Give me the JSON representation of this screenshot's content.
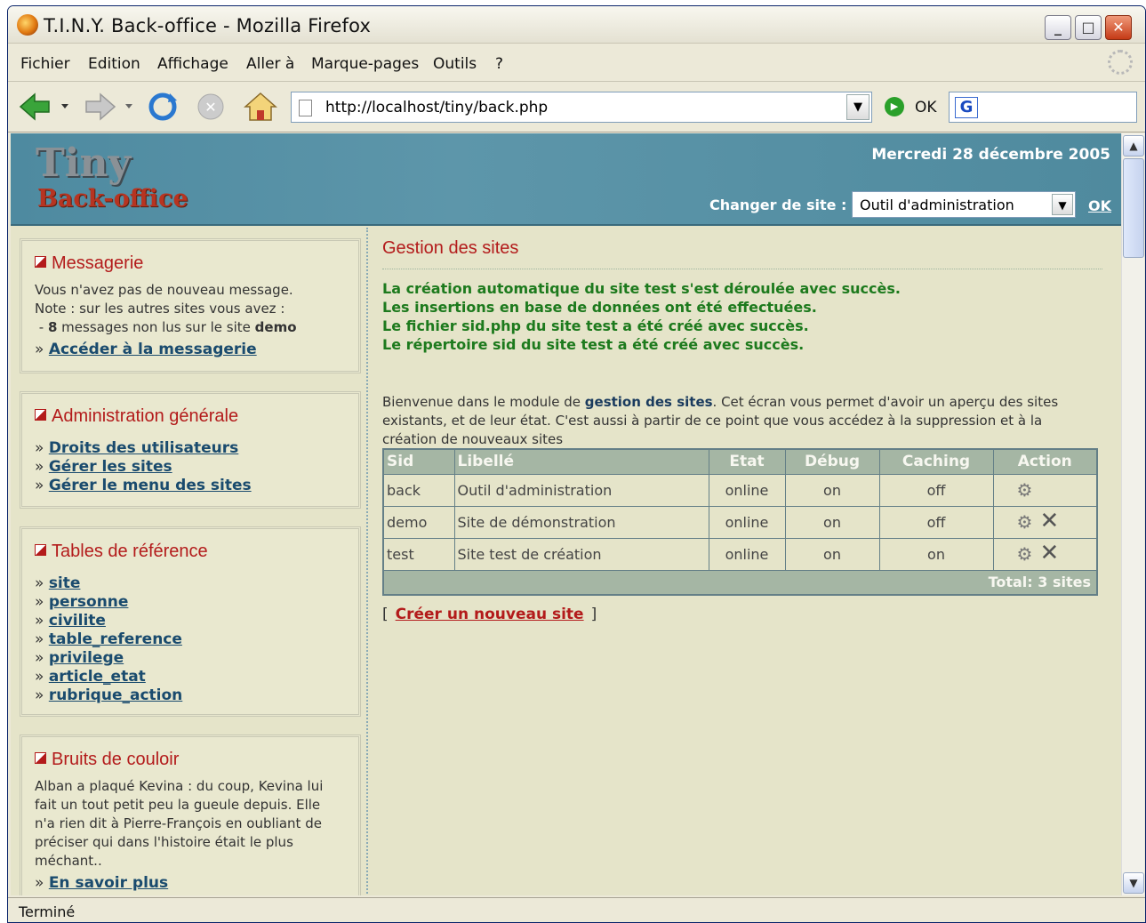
{
  "window": {
    "title": "T.I.N.Y. Back-office - Mozilla Firefox"
  },
  "menubar": {
    "items": [
      "Fichier",
      "Edition",
      "Affichage",
      "Aller à",
      "Marque-pages",
      "Outils",
      "?"
    ]
  },
  "navbar": {
    "url": "http://localhost/tiny/back.php",
    "go_label": "OK"
  },
  "header": {
    "logo_line1": "Tiny",
    "logo_line2": "Back-office",
    "date": "Mercredi 28 décembre 2005",
    "change_site_label": "Changer de site :",
    "site_selected": "Outil d'administration",
    "ok_label": "OK"
  },
  "sidebar": {
    "messagerie": {
      "title": "Messagerie",
      "line1": "Vous n'avez pas de nouveau message.",
      "line2": "Note : sur les autres sites vous avez :",
      "line3_prefix": " - ",
      "line3_count": "8",
      "line3_mid": " messages non lus sur le site ",
      "line3_site": "demo",
      "link": "Accéder à la messagerie"
    },
    "admin": {
      "title": "Administration générale",
      "links": [
        "Droits des utilisateurs",
        "Gérer les sites",
        "Gérer le menu des sites"
      ]
    },
    "tables": {
      "title": "Tables de référence",
      "links": [
        "site",
        "personne",
        "civilite",
        "table_reference",
        "privilege",
        "article_etat",
        "rubrique_action"
      ]
    },
    "bruits": {
      "title": "Bruits de couloir",
      "text": "Alban a plaqué Kevina : du coup, Kevina lui fait un tout petit peu la gueule depuis. Elle n'a rien dit à Pierre-François en oubliant de préciser qui dans l'histoire était le plus méchant..",
      "link": "En savoir plus"
    }
  },
  "main": {
    "title": "Gestion des sites",
    "success": [
      "La création automatique du site test s'est déroulée avec succès.",
      "Les insertions en base de données ont été effectuées.",
      "Le fichier sid.php du site test a été créé avec succès.",
      "Le répertoire sid du site test a été créé avec succès."
    ],
    "intro_a": "Bienvenue dans le module de ",
    "intro_b": "gestion des sites",
    "intro_c": ". Cet écran vous permet d'avoir un aperçu des sites existants, et de leur état. C'est aussi à partir de ce point que vous accédez à la suppression et à la création de nouveaux sites",
    "table": {
      "headers": [
        "Sid",
        "Libellé",
        "Etat",
        "Débug",
        "Caching",
        "Action"
      ],
      "rows": [
        [
          "back",
          "Outil d'administration",
          "online",
          "on",
          "off"
        ],
        [
          "demo",
          "Site de démonstration",
          "online",
          "on",
          "off"
        ],
        [
          "test",
          "Site test de création",
          "online",
          "on",
          "on"
        ]
      ],
      "total": "Total: 3 sites"
    },
    "create_open": "[",
    "create_link": "Créer un nouveau site",
    "create_close": "]"
  },
  "status": {
    "text": "Terminé"
  }
}
